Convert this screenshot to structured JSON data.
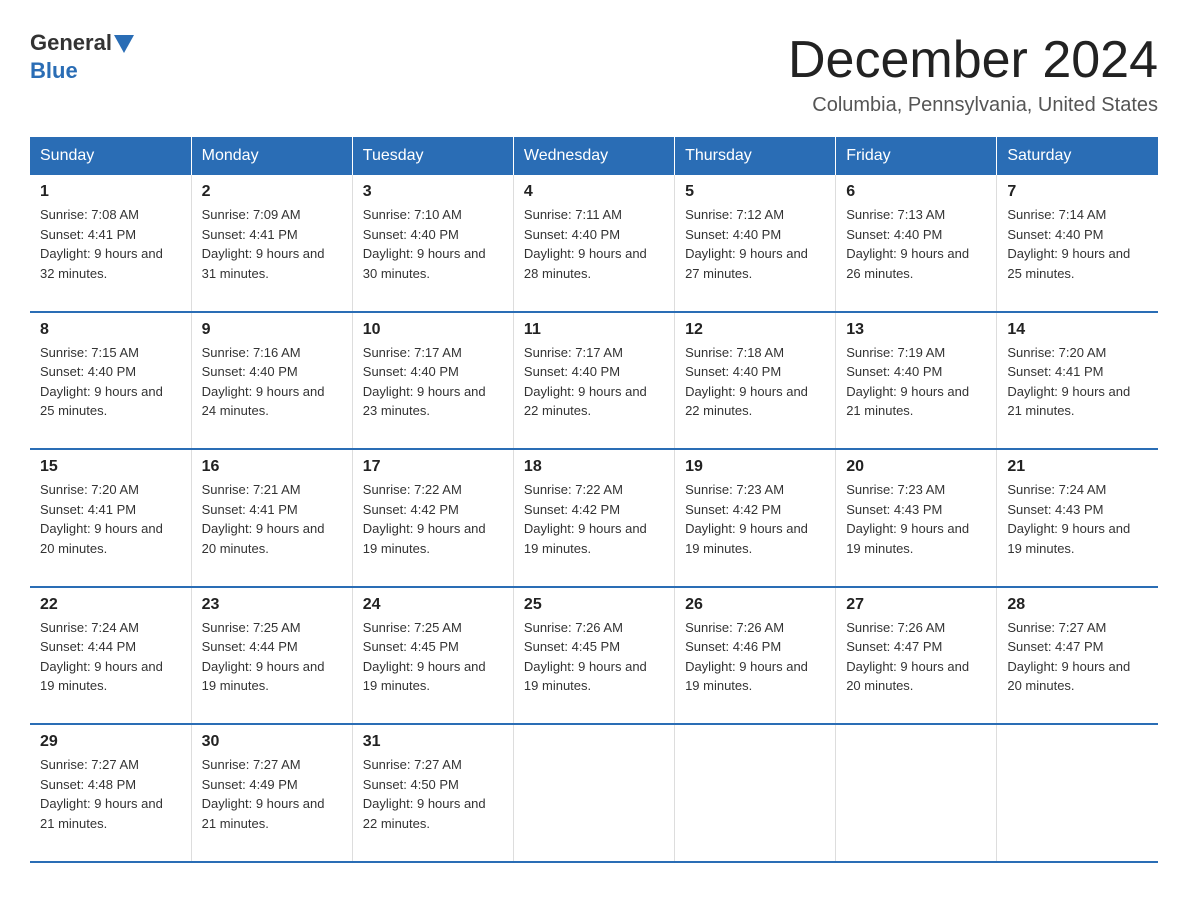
{
  "header": {
    "logo_general": "General",
    "logo_blue": "Blue",
    "month_title": "December 2024",
    "location": "Columbia, Pennsylvania, United States"
  },
  "days_of_week": [
    "Sunday",
    "Monday",
    "Tuesday",
    "Wednesday",
    "Thursday",
    "Friday",
    "Saturday"
  ],
  "weeks": [
    [
      {
        "day": "1",
        "sunrise": "7:08 AM",
        "sunset": "4:41 PM",
        "daylight": "9 hours and 32 minutes."
      },
      {
        "day": "2",
        "sunrise": "7:09 AM",
        "sunset": "4:41 PM",
        "daylight": "9 hours and 31 minutes."
      },
      {
        "day": "3",
        "sunrise": "7:10 AM",
        "sunset": "4:40 PM",
        "daylight": "9 hours and 30 minutes."
      },
      {
        "day": "4",
        "sunrise": "7:11 AM",
        "sunset": "4:40 PM",
        "daylight": "9 hours and 28 minutes."
      },
      {
        "day": "5",
        "sunrise": "7:12 AM",
        "sunset": "4:40 PM",
        "daylight": "9 hours and 27 minutes."
      },
      {
        "day": "6",
        "sunrise": "7:13 AM",
        "sunset": "4:40 PM",
        "daylight": "9 hours and 26 minutes."
      },
      {
        "day": "7",
        "sunrise": "7:14 AM",
        "sunset": "4:40 PM",
        "daylight": "9 hours and 25 minutes."
      }
    ],
    [
      {
        "day": "8",
        "sunrise": "7:15 AM",
        "sunset": "4:40 PM",
        "daylight": "9 hours and 25 minutes."
      },
      {
        "day": "9",
        "sunrise": "7:16 AM",
        "sunset": "4:40 PM",
        "daylight": "9 hours and 24 minutes."
      },
      {
        "day": "10",
        "sunrise": "7:17 AM",
        "sunset": "4:40 PM",
        "daylight": "9 hours and 23 minutes."
      },
      {
        "day": "11",
        "sunrise": "7:17 AM",
        "sunset": "4:40 PM",
        "daylight": "9 hours and 22 minutes."
      },
      {
        "day": "12",
        "sunrise": "7:18 AM",
        "sunset": "4:40 PM",
        "daylight": "9 hours and 22 minutes."
      },
      {
        "day": "13",
        "sunrise": "7:19 AM",
        "sunset": "4:40 PM",
        "daylight": "9 hours and 21 minutes."
      },
      {
        "day": "14",
        "sunrise": "7:20 AM",
        "sunset": "4:41 PM",
        "daylight": "9 hours and 21 minutes."
      }
    ],
    [
      {
        "day": "15",
        "sunrise": "7:20 AM",
        "sunset": "4:41 PM",
        "daylight": "9 hours and 20 minutes."
      },
      {
        "day": "16",
        "sunrise": "7:21 AM",
        "sunset": "4:41 PM",
        "daylight": "9 hours and 20 minutes."
      },
      {
        "day": "17",
        "sunrise": "7:22 AM",
        "sunset": "4:42 PM",
        "daylight": "9 hours and 19 minutes."
      },
      {
        "day": "18",
        "sunrise": "7:22 AM",
        "sunset": "4:42 PM",
        "daylight": "9 hours and 19 minutes."
      },
      {
        "day": "19",
        "sunrise": "7:23 AM",
        "sunset": "4:42 PM",
        "daylight": "9 hours and 19 minutes."
      },
      {
        "day": "20",
        "sunrise": "7:23 AM",
        "sunset": "4:43 PM",
        "daylight": "9 hours and 19 minutes."
      },
      {
        "day": "21",
        "sunrise": "7:24 AM",
        "sunset": "4:43 PM",
        "daylight": "9 hours and 19 minutes."
      }
    ],
    [
      {
        "day": "22",
        "sunrise": "7:24 AM",
        "sunset": "4:44 PM",
        "daylight": "9 hours and 19 minutes."
      },
      {
        "day": "23",
        "sunrise": "7:25 AM",
        "sunset": "4:44 PM",
        "daylight": "9 hours and 19 minutes."
      },
      {
        "day": "24",
        "sunrise": "7:25 AM",
        "sunset": "4:45 PM",
        "daylight": "9 hours and 19 minutes."
      },
      {
        "day": "25",
        "sunrise": "7:26 AM",
        "sunset": "4:45 PM",
        "daylight": "9 hours and 19 minutes."
      },
      {
        "day": "26",
        "sunrise": "7:26 AM",
        "sunset": "4:46 PM",
        "daylight": "9 hours and 19 minutes."
      },
      {
        "day": "27",
        "sunrise": "7:26 AM",
        "sunset": "4:47 PM",
        "daylight": "9 hours and 20 minutes."
      },
      {
        "day": "28",
        "sunrise": "7:27 AM",
        "sunset": "4:47 PM",
        "daylight": "9 hours and 20 minutes."
      }
    ],
    [
      {
        "day": "29",
        "sunrise": "7:27 AM",
        "sunset": "4:48 PM",
        "daylight": "9 hours and 21 minutes."
      },
      {
        "day": "30",
        "sunrise": "7:27 AM",
        "sunset": "4:49 PM",
        "daylight": "9 hours and 21 minutes."
      },
      {
        "day": "31",
        "sunrise": "7:27 AM",
        "sunset": "4:50 PM",
        "daylight": "9 hours and 22 minutes."
      },
      null,
      null,
      null,
      null
    ]
  ]
}
